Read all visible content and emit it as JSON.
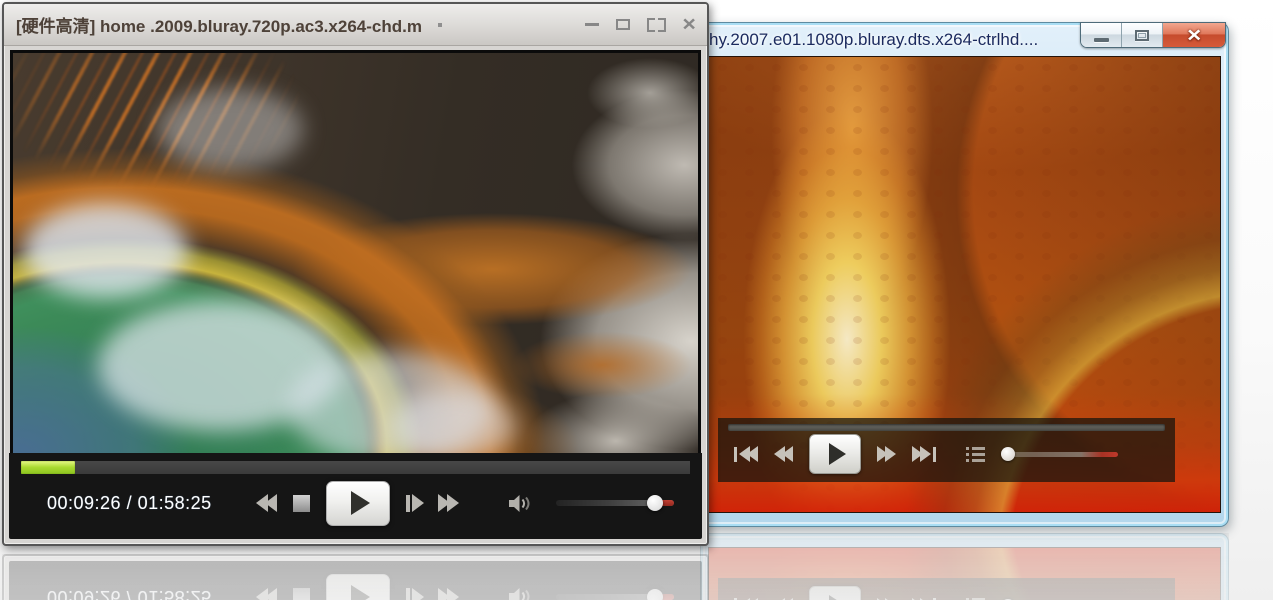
{
  "left_window": {
    "title": "[硬件高清] home .2009.bluray.720p.ac3.x264-chd.m",
    "close_glyph": "×",
    "time_display": "00:09:26 / 01:58:25",
    "progress_percent": 8,
    "volume_percent": 84,
    "colors": {
      "progress_green": "#9cd32a",
      "volume_red": "#a83226",
      "panel_bg": "#151515",
      "titlebar_text": "#4e4239"
    },
    "icons": [
      "pin-dot",
      "minimize",
      "maximize",
      "fullscreen",
      "close",
      "rewind",
      "stop",
      "play",
      "step-forward",
      "fast-forward",
      "speaker",
      "volume-knob"
    ]
  },
  "right_window": {
    "title": "hy.2007.e01.1080p.bluray.dts.x264-ctrlhd....",
    "close_glyph": "×",
    "progress_percent": 0,
    "volume_percent": 4,
    "colors": {
      "frame_blue": "#b4d7ec",
      "close_red": "#d65a3a",
      "title_text": "#1b2a5e",
      "volume_red": "#c0392b"
    },
    "icons": [
      "minimize",
      "maximize",
      "close",
      "previous",
      "rewind",
      "play",
      "fast-forward",
      "next",
      "playlist",
      "volume-knob"
    ]
  }
}
